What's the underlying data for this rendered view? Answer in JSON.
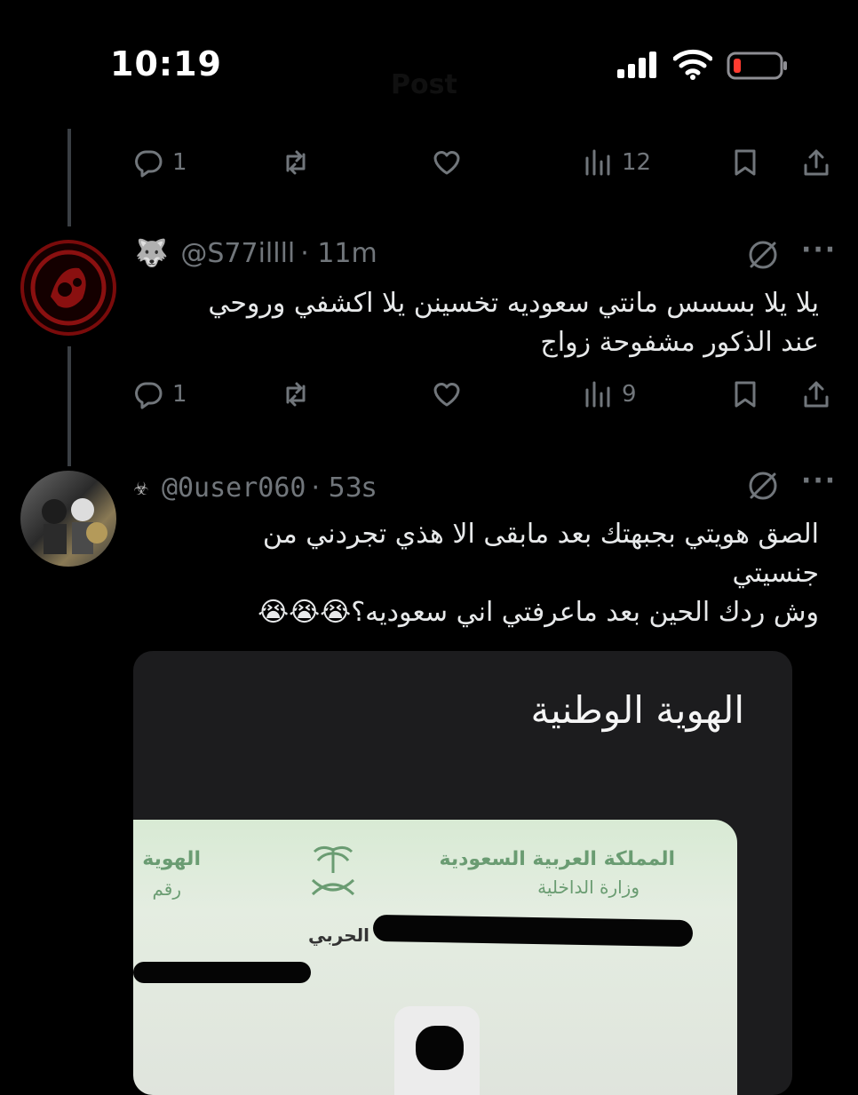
{
  "status_bar": {
    "time": "10:19",
    "faded_title": "Post"
  },
  "tweet_prev": {
    "actions": {
      "replies": "1",
      "views": "12"
    }
  },
  "tweet1": {
    "handle": "@S77illll",
    "time": "· 11m",
    "badge_emoji": "🐺",
    "lines": [
      "يلا يلا بسسس مانتي سعوديه تخسينن يلا اكشفي وروحي",
      "عند الذكور مشفوحة زواج"
    ],
    "actions": {
      "replies": "1",
      "views": "9"
    }
  },
  "tweet2": {
    "handle": "@0user060",
    "time": "· 53s",
    "badge_emoji": "☣",
    "lines": [
      "الصق هويتي بجبهتك بعد مابقى الا هذي تجردني من",
      "جنسيتي",
      "وش ردك الحين بعد ماعرفتي اني سعوديه؟😭😭😭"
    ],
    "media": {
      "title": "الهوية الوطنية",
      "card_kingdom": "المملكة العربية السعودية",
      "card_ministry": "وزارة الداخلية",
      "card_left_label": "الهوية",
      "card_left_sub": "رقم",
      "card_name_fragment": "الحربي"
    }
  },
  "icons": {
    "reply": "reply-icon",
    "retweet": "retweet-icon",
    "like": "heart-icon",
    "views": "views-icon",
    "bookmark": "bookmark-icon",
    "share": "share-icon",
    "grok": "grok-icon",
    "more": "more-icon"
  },
  "colors": {
    "background": "#000000",
    "text": "#e7e9ea",
    "muted": "#71767b",
    "battery_low": "#ff3b30"
  }
}
